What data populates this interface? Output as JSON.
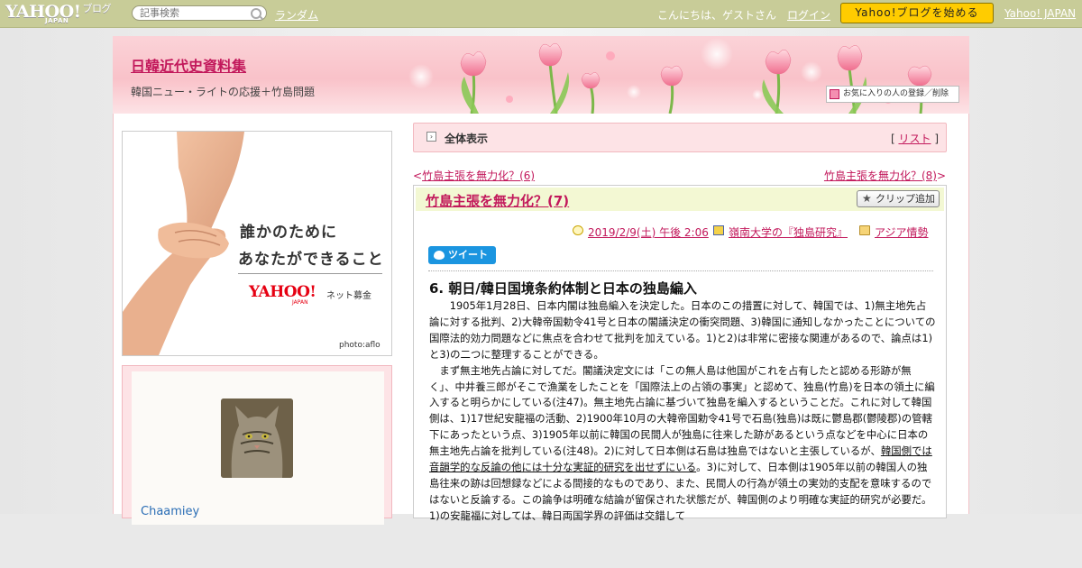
{
  "topbar": {
    "logo_main": "YAHOO!",
    "logo_sub": "JAPAN",
    "logo_blog": "ブログ",
    "search_placeholder": "記事検索",
    "random_label": "ランダム",
    "greeting": "こんにちは、ゲストさん",
    "login_label": "ログイン",
    "start_button": "Yahoo!ブログを始める",
    "yahoo_japan_link": "Yahoo! JAPAN"
  },
  "header": {
    "blog_title": "日韓近代史資料集",
    "blog_description": "韓国ニュー・ライトの応援＋竹島問題",
    "fav_button": "お気に入りの人の登録／削除"
  },
  "banner": {
    "line1": "誰かのために",
    "line2": "あなたができること",
    "brand": "YAHOO!",
    "brand_sub": "JAPAN",
    "bokin": "ネット募金",
    "credit": "photo:aflo"
  },
  "profile": {
    "user_name": "Chaamiey"
  },
  "view_bar": {
    "view_all": "全体表示",
    "list_prefix": "[",
    "list_label": "リスト",
    "list_suffix": "]"
  },
  "nav": {
    "prev": "竹島主張を無力化？(6)",
    "prev_arrow": "<",
    "next": "竹島主張を無力化？(8)",
    "next_arrow": ">"
  },
  "article": {
    "title": "竹島主張を無力化？(7)",
    "clip_button": "クリップ追加",
    "date": "2019/2/9(土) 午後 2:06",
    "source": "嶺南大学の『独島研究』",
    "category": "アジア情勢",
    "tweet_label": "ツイート",
    "section_heading": "6. 朝日/韓日国境条約体制と日本の独島編入",
    "para1": "　　1905年1月28日、日本内閣は独島編入を決定した。日本のこの措置に対して、韓国では、1)無主地先占論に対する批判、2)大韓帝国勅令41号と日本の閣議決定の衝突問題、3)韓国に通知しなかったことについての国際法的効力問題などに焦点を合わせて批判を加えている。1)と2)は非常に密接な関連があるので、論点は1)と3)の二つに整理することができる。",
    "para2_a": "　まず無主地先占論に対してだ。閣議決定文には「この無人島は他国がこれを占有したと認める形跡が無く」、中井養三郎がそこで漁業をしたことを「国際法上の占領の事実」と認めて、独島(竹島)を日本の領土に編入すると明らかにしている(注47)。無主地先占論に基づいて独島を編入するということだ。これに対して韓国側は、1)17世紀安龍福の活動、2)1900年10月の大韓帝国勅令41号で石島(独島)は既に鬱島郡(鬱陵郡)の管轄下にあったという点、3)1905年以前に韓国の民間人が独島に往来した跡があるという点などを中心に日本の無主地先占論を批判している(注48)。2)に対して日本側は石島は独島ではないと主張しているが、",
    "para2_underline": "韓国側では音韻学的な反論の他には十分な実証的研究を出せずにいる",
    "para2_b": "。3)に対して、日本側は1905年以前の韓国人の独島往来の跡は回想録などによる間接的なものであり、また、民間人の行為が領土の実効的支配を意味するのではないと反論する。この論争は明確な結論が留保された状態だが、韓国側のより明確な実証的研究が必要だ。1)の安龍福に対しては、韓日両国学界の評価は交錯して"
  },
  "colors": {
    "topbar": "#c8cc98",
    "accent": "#c2185b",
    "header_pink": "#f9c2c9",
    "title_bar": "#f3f8d3",
    "start_button": "#ffcc00",
    "tweet_blue": "#1b95e0"
  },
  "icons": [
    "search-icon",
    "heart-icon",
    "star-icon",
    "clock-icon",
    "book-icon",
    "folder-icon",
    "twitter-bird-icon",
    "expand-icon"
  ]
}
